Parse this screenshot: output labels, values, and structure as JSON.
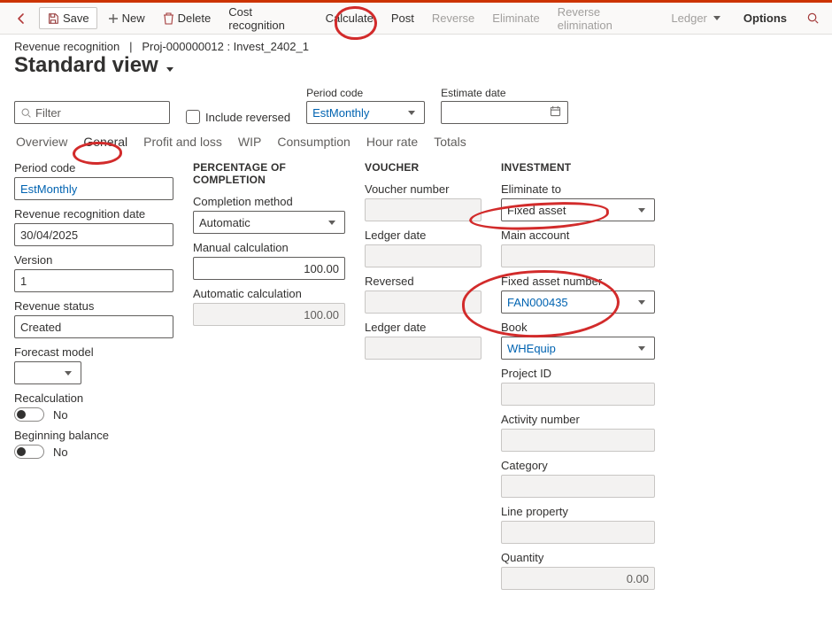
{
  "toolbar": {
    "save": "Save",
    "new": "New",
    "delete": "Delete",
    "cost_recognition": "Cost recognition",
    "calculate": "Calculate",
    "post": "Post",
    "reverse": "Reverse",
    "eliminate": "Eliminate",
    "reverse_elimination": "Reverse elimination",
    "ledger": "Ledger",
    "options": "Options"
  },
  "breadcrumb": {
    "module": "Revenue recognition",
    "sep": "|",
    "project": "Proj-000000012 : Invest_2402_1"
  },
  "page_title": "Standard view",
  "filter": {
    "placeholder": "Filter",
    "include_reversed_label": "Include reversed",
    "period_code_label": "Period code",
    "period_code_value": "EstMonthly",
    "estimate_date_label": "Estimate date",
    "estimate_date_value": ""
  },
  "tabs": [
    "Overview",
    "General",
    "Profit and loss",
    "WIP",
    "Consumption",
    "Hour rate",
    "Totals"
  ],
  "active_tab": "General",
  "col1": {
    "period_code": {
      "label": "Period code",
      "value": "EstMonthly"
    },
    "rev_date": {
      "label": "Revenue recognition date",
      "value": "30/04/2025"
    },
    "version": {
      "label": "Version",
      "value": "1"
    },
    "revenue_status": {
      "label": "Revenue status",
      "value": "Created"
    },
    "forecast_model": {
      "label": "Forecast model",
      "value": ""
    },
    "recalculation": {
      "label": "Recalculation",
      "value": "No"
    },
    "beginning_balance": {
      "label": "Beginning balance",
      "value": "No"
    }
  },
  "col2": {
    "section": "PERCENTAGE OF COMPLETION",
    "completion_method": {
      "label": "Completion method",
      "value": "Automatic"
    },
    "manual_calc": {
      "label": "Manual calculation",
      "value": "100.00"
    },
    "auto_calc": {
      "label": "Automatic calculation",
      "value": "100.00"
    }
  },
  "col3": {
    "section": "VOUCHER",
    "voucher_number": {
      "label": "Voucher number",
      "value": ""
    },
    "ledger_date1": {
      "label": "Ledger date",
      "value": ""
    },
    "reversed": {
      "label": "Reversed",
      "value": ""
    },
    "ledger_date2": {
      "label": "Ledger date",
      "value": ""
    }
  },
  "col4": {
    "section": "INVESTMENT",
    "eliminate_to": {
      "label": "Eliminate to",
      "value": "Fixed asset"
    },
    "main_account": {
      "label": "Main account",
      "value": ""
    },
    "fixed_asset_number": {
      "label": "Fixed asset number",
      "value": "FAN000435"
    },
    "book": {
      "label": "Book",
      "value": "WHEquip"
    },
    "project_id": {
      "label": "Project ID",
      "value": ""
    },
    "activity_number": {
      "label": "Activity number",
      "value": ""
    },
    "category": {
      "label": "Category",
      "value": ""
    },
    "line_property": {
      "label": "Line property",
      "value": ""
    },
    "quantity": {
      "label": "Quantity",
      "value": "0.00"
    }
  }
}
